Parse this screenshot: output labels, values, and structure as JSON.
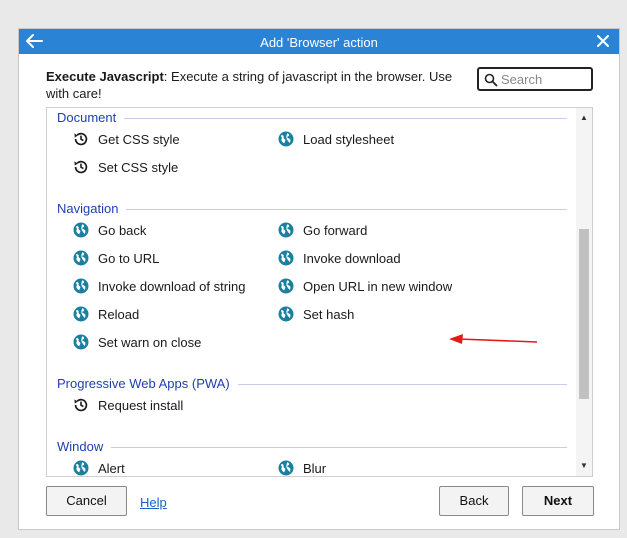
{
  "dialog": {
    "title": "Add 'Browser' action",
    "description_bold": "Execute Javascript",
    "description_rest": ": Execute a string of javascript in the browser. Use with care!",
    "search_placeholder": "Search",
    "search_value": ""
  },
  "sections": [
    {
      "label": "Document",
      "items": [
        {
          "label": "Get CSS style",
          "icon": "refresh-clock-icon"
        },
        {
          "label": "Load stylesheet",
          "icon": "globe-icon"
        },
        {
          "label": "Set CSS style",
          "icon": "refresh-clock-icon"
        }
      ]
    },
    {
      "label": "Navigation",
      "items": [
        {
          "label": "Go back",
          "icon": "globe-icon"
        },
        {
          "label": "Go forward",
          "icon": "globe-icon"
        },
        {
          "label": "Go to URL",
          "icon": "globe-icon"
        },
        {
          "label": "Invoke download",
          "icon": "globe-icon"
        },
        {
          "label": "Invoke download of string",
          "icon": "globe-icon"
        },
        {
          "label": "Open URL in new window",
          "icon": "globe-icon"
        },
        {
          "label": "Reload",
          "icon": "globe-icon"
        },
        {
          "label": "Set hash",
          "icon": "globe-icon"
        },
        {
          "label": "Set warn on close",
          "icon": "globe-icon"
        }
      ]
    },
    {
      "label": "Progressive Web Apps (PWA)",
      "items": [
        {
          "label": "Request install",
          "icon": "refresh-clock-icon"
        }
      ]
    },
    {
      "label": "Window",
      "items": [
        {
          "label": "Alert",
          "icon": "globe-icon"
        },
        {
          "label": "Blur",
          "icon": "globe-icon"
        }
      ]
    }
  ],
  "footer": {
    "cancel_label": "Cancel",
    "help_label": "Help",
    "back_label": "Back",
    "next_label": "Next"
  },
  "colors": {
    "titlebar": "#2b83d6",
    "section_label": "#1f3fae",
    "globe_icon": "#1b7fa0",
    "annotation_arrow": "#e01b1b"
  }
}
